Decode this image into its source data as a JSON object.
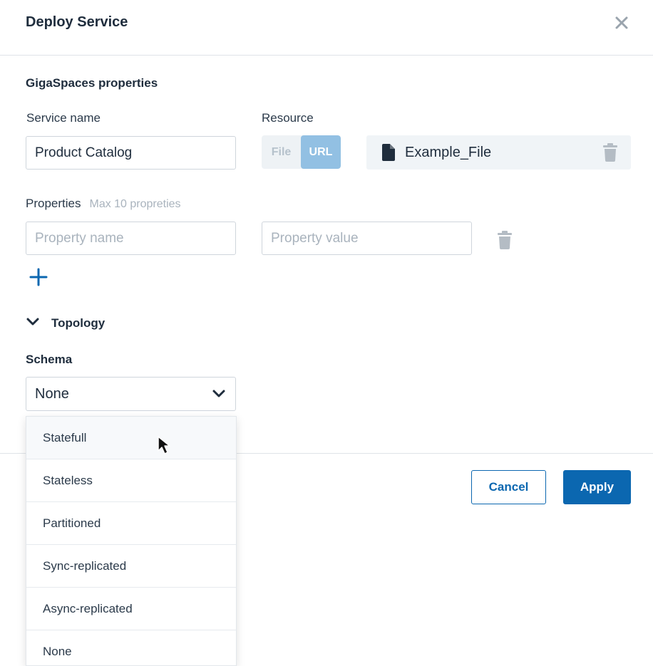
{
  "dialog": {
    "title": "Deploy Service",
    "section_title": "GigaSpaces properties"
  },
  "service_name": {
    "label": "Service name",
    "value": "Product Catalog"
  },
  "resource": {
    "label": "Resource",
    "options": [
      "File",
      "URL"
    ],
    "selected": "URL",
    "file_name": "Example_File"
  },
  "properties": {
    "label": "Properties",
    "hint": "Max 10 propreties",
    "name_placeholder": "Property name",
    "value_placeholder": "Property value"
  },
  "topology": {
    "label": "Topology",
    "expanded": true
  },
  "schema": {
    "label": "Schema",
    "selected": "None",
    "options": [
      "Statefull",
      "Stateless",
      "Partitioned",
      "Sync-replicated",
      "Async-replicated",
      "None"
    ],
    "hovered": "Statefull"
  },
  "footer": {
    "cancel_label": "Cancel",
    "apply_label": "Apply"
  },
  "icons": {
    "close": "close-icon",
    "file": "file-icon",
    "trash": "trash-icon",
    "add": "plus-icon",
    "chevron": "chevron-down-icon",
    "cursor": "mouse-pointer-icon"
  },
  "colors": {
    "primary": "#0b67b0",
    "toggle_active": "#92c0e3",
    "muted_text": "#a9b3bd",
    "icon_gray": "#b4bcc4"
  }
}
